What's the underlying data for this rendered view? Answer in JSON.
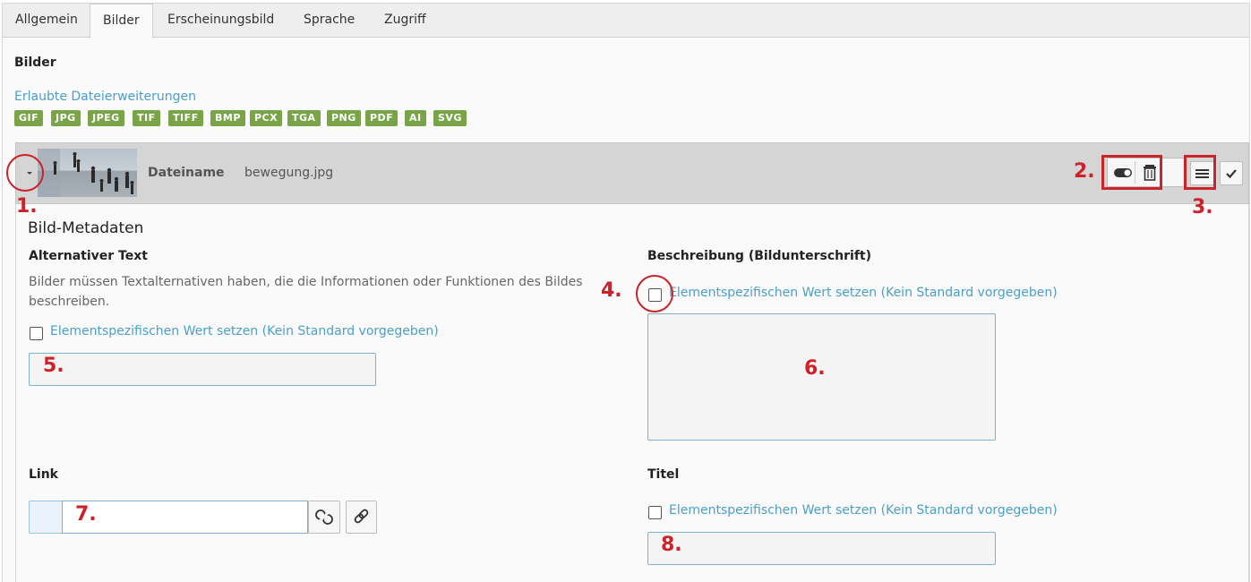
{
  "tabs": [
    {
      "label": "Allgemein"
    },
    {
      "label": "Bilder"
    },
    {
      "label": "Erscheinungsbild"
    },
    {
      "label": "Sprache"
    },
    {
      "label": "Zugriff"
    }
  ],
  "section": {
    "title": "Bilder",
    "allowed_label": "Erlaubte Dateierweiterungen",
    "extensions": [
      "GIF",
      "JPG",
      "JPEG",
      "TIF",
      "TIFF",
      "BMP",
      "PCX",
      "TGA",
      "PNG",
      "PDF",
      "AI",
      "SVG"
    ]
  },
  "file": {
    "name_label": "Dateiname",
    "name_value": "bewegung.jpg"
  },
  "metadata": {
    "title": "Bild-Metadaten",
    "alt": {
      "label": "Alternativer Text",
      "hint": "Bilder müssen Textalternativen haben, die die Informationen oder Funktionen des Bildes beschreiben.",
      "override_label": "Elementspezifischen Wert setzen (Kein Standard vorgegeben)"
    },
    "description": {
      "label": "Beschreibung (Bildunterschrift)",
      "override_label": "Elementspezifischen Wert setzen (Kein Standard vorgegeben)"
    },
    "link": {
      "label": "Link"
    },
    "title_field": {
      "label": "Titel",
      "override_label": "Elementspezifischen Wert setzen (Kein Standard vorgegeben)"
    }
  },
  "annotations": [
    "1.",
    "2.",
    "3.",
    "4.",
    "5.",
    "6.",
    "7.",
    "8."
  ],
  "colors": {
    "annotation": "#cc2229",
    "extension_badge": "#79a548",
    "link_text": "#4ba0c8"
  }
}
